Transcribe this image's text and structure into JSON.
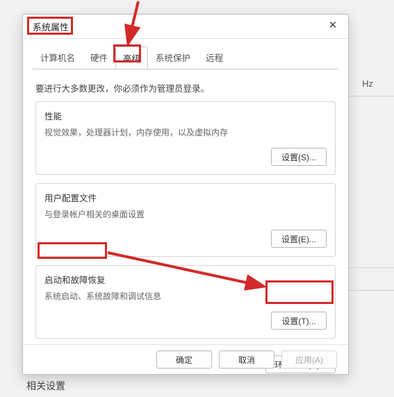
{
  "host": {
    "hz": "Hz",
    "footer": "相关设置"
  },
  "dialog": {
    "title": "系统属性",
    "tabs": [
      "计算机名",
      "硬件",
      "高级",
      "系统保护",
      "远程"
    ],
    "active_tab_index": 2,
    "notice": "要进行大多数更改，你必须作为管理员登录。",
    "groups": [
      {
        "title": "性能",
        "desc": "视觉效果，处理器计划，内存使用，以及虚拟内存",
        "button": "设置(S)..."
      },
      {
        "title": "用户配置文件",
        "desc": "与登录帐户相关的桌面设置",
        "button": "设置(E)..."
      },
      {
        "title": "启动和故障恢复",
        "desc": "系统启动、系统故障和调试信息",
        "button": "设置(T)..."
      }
    ],
    "env_button": "环境变量(N)...",
    "footer": {
      "ok": "确定",
      "cancel": "取消",
      "apply": "应用(A)"
    }
  }
}
